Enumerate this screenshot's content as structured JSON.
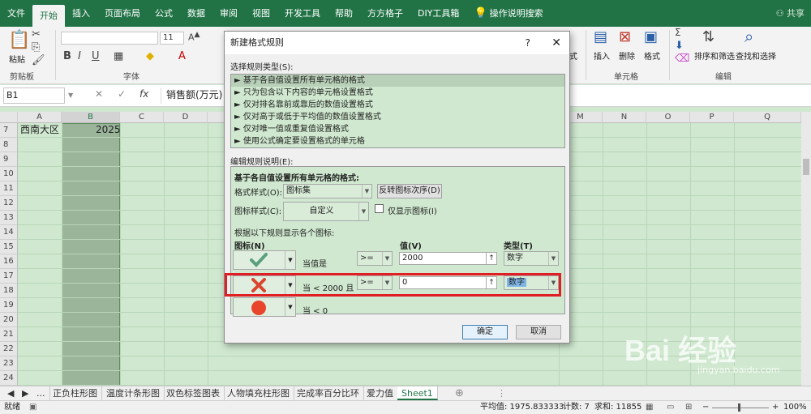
{
  "tabs": [
    "文件",
    "开始",
    "插入",
    "页面布局",
    "公式",
    "数据",
    "审阅",
    "视图",
    "开发工具",
    "帮助",
    "方方格子",
    "DIY工具箱"
  ],
  "tell_me": "操作说明搜索",
  "share": "共享",
  "ribbon": {
    "paste": "粘贴",
    "clipboard": "剪贴板",
    "font_group": "字体",
    "font_size": "11",
    "format_label": "式",
    "insert": "插入",
    "delete": "删除",
    "format": "格式",
    "cells_group": "单元格",
    "sort_filter": "排序和筛选",
    "find_select": "查找和选择",
    "edit_group": "编辑"
  },
  "formula_bar": {
    "name_box": "B1",
    "content": "销售额(万元)"
  },
  "grid": {
    "columns": [
      "A",
      "B",
      "C",
      "D",
      "M",
      "N",
      "O",
      "P",
      "Q"
    ],
    "rows": [
      "7",
      "8",
      "9",
      "10",
      "11",
      "12",
      "13",
      "14",
      "15",
      "16",
      "17",
      "18",
      "19",
      "20",
      "21",
      "22",
      "23",
      "24"
    ],
    "a7": "西南大区",
    "b7": "2025"
  },
  "sheet_tabs": [
    "正负柱形图",
    "温度计条形图",
    "双色标签图表",
    "人物填充柱形图",
    "完成率百分比环",
    "爱力值",
    "Sheet1"
  ],
  "sheet_nav": "...",
  "status": {
    "ready": "就绪",
    "avg": "平均值: 1975.833333",
    "count": "计数: 7",
    "sum": "求和: 11855",
    "zoom": "100%"
  },
  "dialog": {
    "title": "新建格式规则",
    "help": "?",
    "close": "✕",
    "select_type_label": "选择规则类型(S):",
    "rule_types": [
      "► 基于各自值设置所有单元格的格式",
      "► 只为包含以下内容的单元格设置格式",
      "► 仅对排名靠前或靠后的数值设置格式",
      "► 仅对高于或低于平均值的数值设置格式",
      "► 仅对唯一值或重复值设置格式",
      "► 使用公式确定要设置格式的单元格"
    ],
    "edit_label": "编辑规则说明(E):",
    "section_title": "基于各自值设置所有单元格的格式:",
    "format_style_label": "格式样式(O):",
    "format_style_value": "图标集",
    "reverse_button": "反转图标次序(D)",
    "icon_style_label": "图标样式(C):",
    "icon_style_value": "自定义",
    "show_icon_only": "仅显示图标(I)",
    "rule_intro": "根据以下规则显示各个图标:",
    "col_icon": "图标(N)",
    "col_value": "值(V)",
    "col_type": "类型(T)",
    "rules": [
      {
        "when": "当值是",
        "op": ">=",
        "value": "2000",
        "type": "数字"
      },
      {
        "when": "当 < 2000 且",
        "op": ">=",
        "value": "0",
        "type": "数字"
      },
      {
        "when": "当 < 0"
      }
    ],
    "ok": "确定",
    "cancel": "取消"
  },
  "watermark": {
    "logo": "Bai 经验",
    "url": "jingyan.baidu.com"
  },
  "colors": {
    "excel_green": "#217346",
    "sheet_bg": "#cfe8cf",
    "highlight": "#e01e24",
    "check": "#5aa07f",
    "cross": "#d9452f",
    "circle": "#e8452c"
  }
}
